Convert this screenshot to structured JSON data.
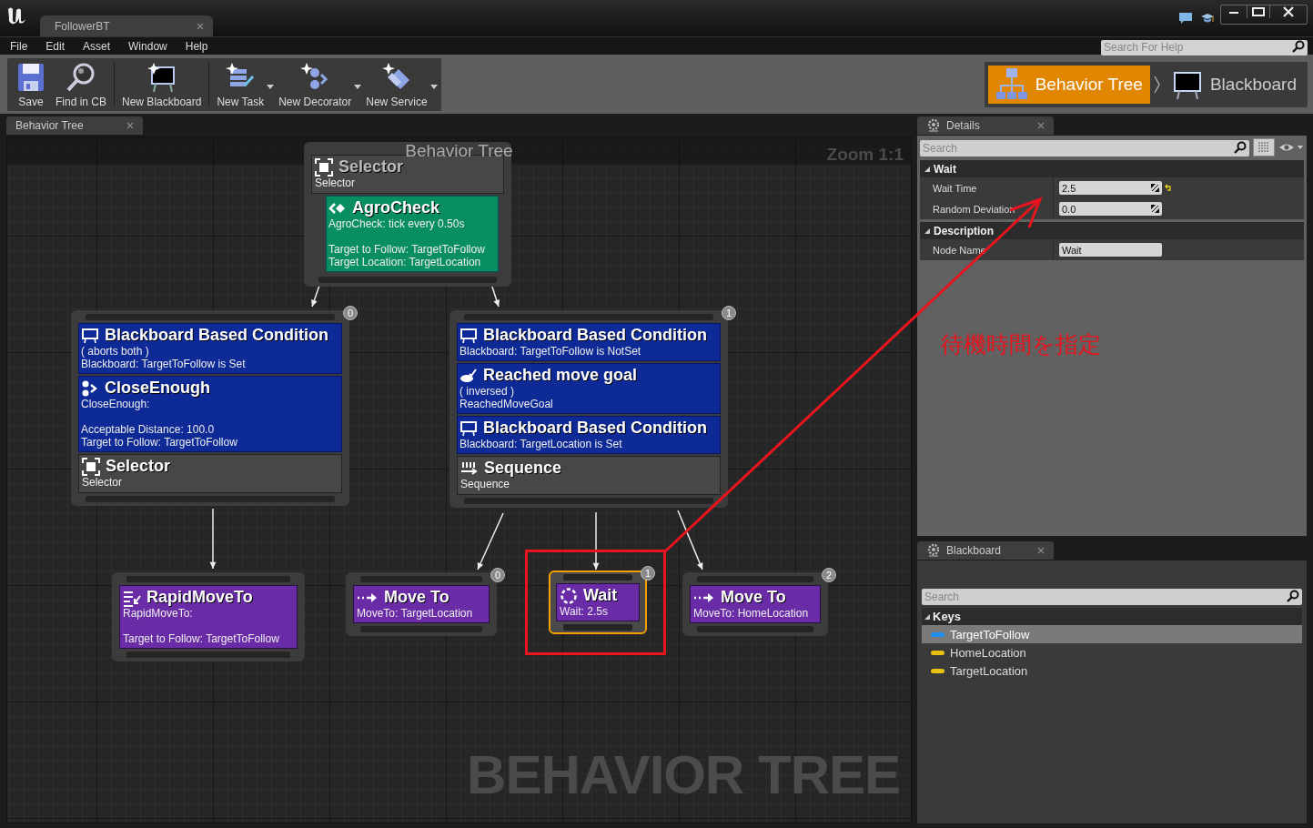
{
  "window": {
    "tab_title": "FollowerBT"
  },
  "menu": [
    {
      "label": "File"
    },
    {
      "label": "Edit"
    },
    {
      "label": "Asset"
    },
    {
      "label": "Window"
    },
    {
      "label": "Help"
    }
  ],
  "help_search": {
    "placeholder": "Search For Help"
  },
  "toolbar": [
    {
      "label": "Save",
      "kind": "save",
      "dropdown": false,
      "separator_before": false
    },
    {
      "label": "Find in CB",
      "kind": "find",
      "dropdown": false,
      "separator_before": false
    },
    {
      "label": "New Blackboard",
      "kind": "blackboard",
      "dropdown": false,
      "separator_before": true
    },
    {
      "label": "New Task",
      "kind": "task",
      "dropdown": true,
      "separator_before": true
    },
    {
      "label": "New Decorator",
      "kind": "decorator",
      "dropdown": true,
      "separator_before": false
    },
    {
      "label": "New Service",
      "kind": "service",
      "dropdown": true,
      "separator_before": false
    }
  ],
  "mode_switcher": [
    {
      "label": "Behavior Tree",
      "kind": "tree",
      "selected": true
    },
    {
      "label": "Blackboard",
      "kind": "blackboard",
      "selected": false
    }
  ],
  "graph": {
    "tab": "Behavior Tree",
    "title": "Behavior Tree",
    "zoom": "Zoom 1:1",
    "watermark": "BEHAVIOR TREE",
    "nodes": [
      {
        "kind": "selector",
        "title": "Selector",
        "subtitle": "Selector",
        "selected": false,
        "services": [
          {
            "kind": "service",
            "title": "AgroCheck",
            "blocks": [
              [
                "AgroCheck: tick every 0.50s"
              ],
              [
                "Target to Follow: TargetToFollow",
                "Target Location: TargetLocation"
              ]
            ]
          }
        ]
      },
      {
        "kind": "selector",
        "title": "Selector",
        "subtitle": "Selector",
        "index": "0",
        "selected": false,
        "decorators": [
          {
            "kind": "blackboard",
            "title": "Blackboard Based Condition",
            "blocks": [
              [
                "( aborts both )",
                "Blackboard: TargetToFollow is Set"
              ]
            ]
          },
          {
            "kind": "custom",
            "title": "CloseEnough",
            "blocks": [
              [
                "CloseEnough:"
              ],
              [
                "Acceptable Distance: 100.0",
                "Target to Follow: TargetToFollow"
              ]
            ]
          }
        ]
      },
      {
        "kind": "sequence",
        "title": "Sequence",
        "subtitle": "Sequence",
        "index": "1",
        "selected": false,
        "decorators": [
          {
            "kind": "blackboard",
            "title": "Blackboard Based Condition",
            "blocks": [
              [
                "Blackboard: TargetToFollow is NotSet"
              ]
            ]
          },
          {
            "kind": "goal",
            "title": "Reached move goal",
            "blocks": [
              [
                "( inversed )",
                "ReachedMoveGoal"
              ]
            ]
          },
          {
            "kind": "blackboard",
            "title": "Blackboard Based Condition",
            "blocks": [
              [
                "Blackboard: TargetLocation is Set"
              ]
            ]
          }
        ]
      },
      {
        "kind": "rapidmove",
        "title": "RapidMoveTo",
        "blocks": [
          [
            "RapidMoveTo:"
          ],
          [
            "Target to Follow: TargetToFollow"
          ]
        ],
        "selected": false
      },
      {
        "kind": "moveto",
        "title": "Move To",
        "blocks": [
          [
            "MoveTo: TargetLocation"
          ]
        ],
        "index": "0",
        "selected": false
      },
      {
        "kind": "wait",
        "title": "Wait",
        "blocks": [
          [
            "Wait: 2.5s"
          ]
        ],
        "index": "1",
        "selected": true
      },
      {
        "kind": "moveto",
        "title": "Move To",
        "blocks": [
          [
            "MoveTo: HomeLocation"
          ]
        ],
        "index": "2",
        "selected": false
      }
    ]
  },
  "details": {
    "tab": "Details",
    "search": {
      "placeholder": "Search"
    },
    "categories": [
      {
        "title": "Wait",
        "expanded": true,
        "properties": [
          {
            "label": "Wait Time",
            "value": "2.5",
            "kind": "number",
            "modified": true
          },
          {
            "label": "Random Deviation",
            "value": "0.0",
            "kind": "number",
            "modified": false
          }
        ]
      },
      {
        "title": "Description",
        "expanded": true,
        "properties": [
          {
            "label": "Node Name",
            "value": "Wait",
            "kind": "text",
            "modified": false
          }
        ]
      }
    ]
  },
  "blackboard": {
    "tab": "Blackboard",
    "search": {
      "placeholder": "Search"
    },
    "section": {
      "title": "Keys",
      "expanded": true
    },
    "keys": [
      {
        "name": "TargetToFollow",
        "color": "#1e8ff0",
        "selected": true
      },
      {
        "name": "HomeLocation",
        "color": "#e8c010",
        "selected": false
      },
      {
        "name": "TargetLocation",
        "color": "#e8c010",
        "selected": false
      }
    ]
  },
  "annotation": {
    "text": "待機時間を指定"
  }
}
